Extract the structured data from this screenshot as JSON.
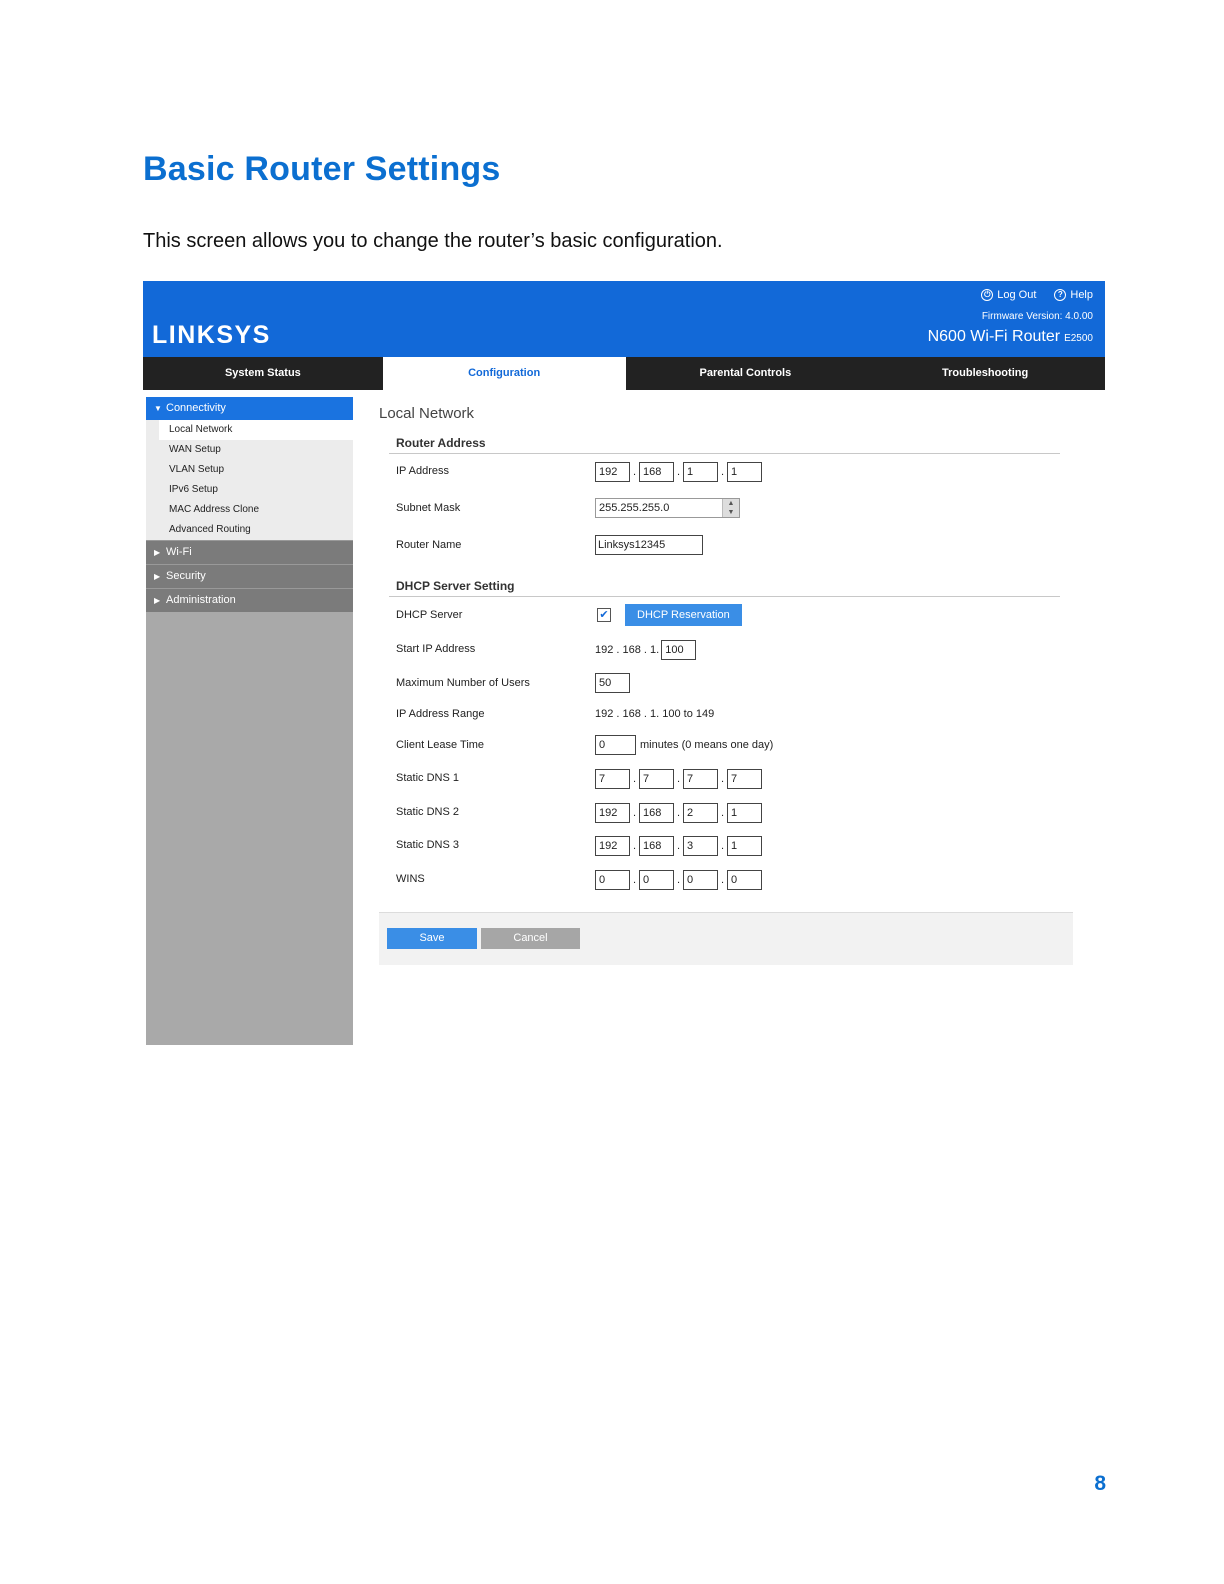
{
  "doc": {
    "title": "Basic Router Settings",
    "intro": "This screen allows you to change the router’s basic configuration.",
    "page_number": "8"
  },
  "header": {
    "logo": "LINKSYS",
    "logout_label": "Log Out",
    "help_label": "Help",
    "firmware": "Firmware Version: 4.0.00",
    "model": "N600 Wi-Fi Router",
    "model_code": "E2500",
    "brand_color": "#1269d8"
  },
  "nav": {
    "tabs": [
      {
        "label": "System Status"
      },
      {
        "label": "Configuration"
      },
      {
        "label": "Parental Controls"
      },
      {
        "label": "Troubleshooting"
      }
    ],
    "active": "Configuration"
  },
  "sidebar": {
    "head": "Connectivity",
    "items": [
      {
        "label": "Local Network"
      },
      {
        "label": "WAN Setup"
      },
      {
        "label": "VLAN Setup"
      },
      {
        "label": "IPv6 Setup"
      },
      {
        "label": "MAC Address Clone"
      },
      {
        "label": "Advanced Routing"
      }
    ],
    "groups": [
      {
        "label": "Wi-Fi"
      },
      {
        "label": "Security"
      },
      {
        "label": "Administration"
      }
    ]
  },
  "content": {
    "title": "Local Network",
    "router_address": {
      "heading": "Router Address",
      "ip_label": "IP Address",
      "ip": [
        "192",
        "168",
        "1",
        "1"
      ],
      "subnet_label": "Subnet Mask",
      "subnet": "255.255.255.0",
      "name_label": "Router Name",
      "name": "Linksys12345"
    },
    "dhcp": {
      "heading": "DHCP Server Setting",
      "server_label": "DHCP Server",
      "server_enabled": "✔",
      "reservation_button": "DHCP Reservation",
      "start_label": "Start IP Address",
      "start_prefix": "192 . 168 . 1.",
      "start_value": "100",
      "max_label": "Maximum Number of  Users",
      "max_value": "50",
      "range_label": "IP Address Range",
      "range_value": "192 . 168 . 1. 100 to 149",
      "lease_label": "Client Lease Time",
      "lease_value": "0",
      "lease_note": "minutes (0 means one day)",
      "dns1_label": "Static DNS 1",
      "dns1": [
        "7",
        "7",
        "7",
        "7"
      ],
      "dns2_label": "Static DNS 2",
      "dns2": [
        "192",
        "168",
        "2",
        "1"
      ],
      "dns3_label": "Static DNS 3",
      "dns3": [
        "192",
        "168",
        "3",
        "1"
      ],
      "wins_label": "WINS",
      "wins": [
        "0",
        "0",
        "0",
        "0"
      ]
    },
    "save_label": "Save",
    "cancel_label": "Cancel"
  }
}
